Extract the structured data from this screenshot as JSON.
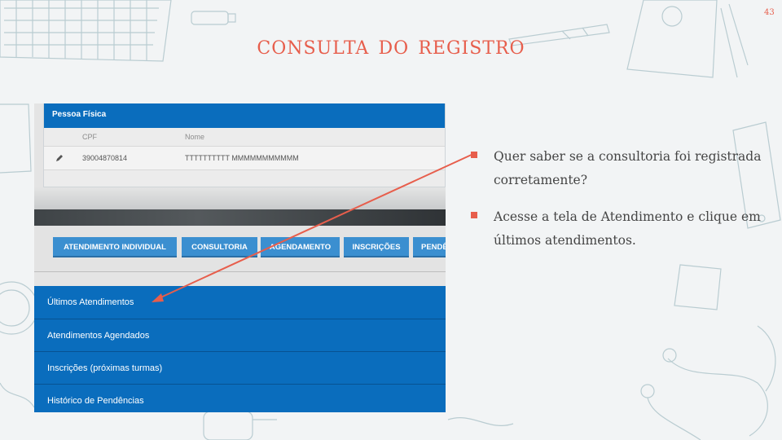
{
  "slide": {
    "title": "consulta do registro",
    "page_number": "43"
  },
  "screenshot": {
    "panel_header": "Pessoa Física",
    "columns": [
      "CPF",
      "Nome"
    ],
    "row": {
      "cpf": "39004870814",
      "name": "TTTTTTTTTT MMMMMMMMMMM"
    },
    "tabs": [
      "ATENDIMENTO INDIVIDUAL",
      "CONSULTORIA",
      "AGENDAMENTO",
      "INSCRIÇÕES",
      "PENDÊNCIAS"
    ],
    "menu": [
      "Últimos Atendimentos",
      "Atendimentos Agendados",
      "Inscrições (próximas turmas)",
      "Histórico de Pendências"
    ]
  },
  "bullets": [
    "Quer saber se a consultoria foi registrada corretamente?",
    "Acesse a tela de Atendimento e clique em últimos atendimentos."
  ],
  "colors": {
    "accent": "#e75e4c",
    "menu_blue": "#0a6dbd",
    "tab_blue": "#3b8fd0",
    "background": "#f2f4f5"
  }
}
